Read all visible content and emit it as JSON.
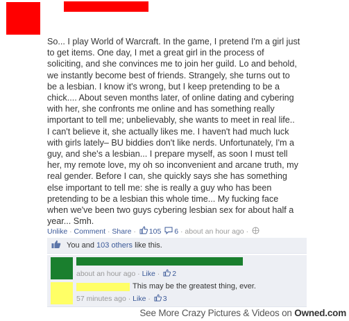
{
  "post": {
    "lines": [
      "So... I play World of Warcraft. In the game, I pretend I'm a girl just",
      "to get items. One day, I met a great girl in the process of",
      "soliciting, and she convinces me to join her guild. Lo and behold,",
      "we instantly become best of friends. Strangely, she turns out to",
      "be a lesbian. I know it's wrong, but I keep pretending to be a",
      "chick.... About seven months later, of online dating and cybering",
      "with her, she confronts me online and has something really",
      "important to tell me; unbelievably, she wants to meet in real life..",
      "I can't believe it, she actually likes me. I haven't had much luck",
      "with girls lately– BU biddies don't like nerds. Unfortunately, I'm a",
      "guy, and she's a lesbian... I prepare myself, as soon I must tell",
      "her, my remote love, my oh so inconvenient and arcane truth, my",
      "real gender. Before I can, she quickly says she has something",
      "else important to tell me: she is really a guy who has been",
      "pretending to be a lesbian this whole time... My fucking face",
      "when we've been two guys cybering lesbian sex for about half a",
      "year... Smh."
    ],
    "actions": {
      "unlike": "Unlike",
      "comment": "Comment",
      "share": "Share",
      "like_count": "105",
      "comment_count": "6",
      "time": "about an hour ago",
      "separator": "·"
    }
  },
  "likes_bar": {
    "you_and": "You and",
    "others": "103 others",
    "like_this": "like this."
  },
  "comments": [
    {
      "text": "",
      "time": "about an hour ago",
      "like_label": "Like",
      "like_count": "2",
      "redaction_color": "#1a7f2e"
    },
    {
      "text": "This may be the greatest thing, ever.",
      "time": "57 minutes ago",
      "like_label": "Like",
      "like_count": "3",
      "redaction_color": "#ffff66"
    }
  ],
  "redactions": {
    "post_color": "#ff0000"
  },
  "footer": {
    "prefix": "See More Crazy Pictures & Videos on",
    "brand": "Owned.com"
  },
  "colors": {
    "link": "#3b5998",
    "muted": "#999999",
    "comment_bg": "#edeff4"
  }
}
